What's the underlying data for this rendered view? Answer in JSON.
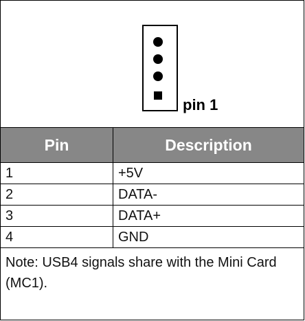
{
  "diagram": {
    "pin_label": "pin 1",
    "pin_count": 4
  },
  "table": {
    "columns": [
      "Pin",
      "Description"
    ],
    "rows": [
      {
        "pin": "1",
        "description": "+5V"
      },
      {
        "pin": "2",
        "description": "DATA-"
      },
      {
        "pin": "3",
        "description": "DATA+"
      },
      {
        "pin": "4",
        "description": "GND"
      }
    ],
    "note": "Note: USB4 signals share with the Mini Card (MC1)."
  },
  "colors": {
    "header_background": "#878787",
    "header_text": "#ffffff",
    "border": "#000000"
  }
}
